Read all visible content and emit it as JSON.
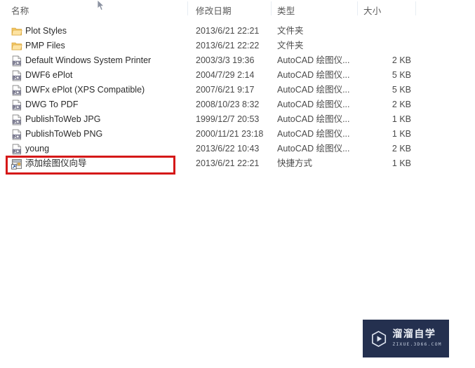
{
  "columns": {
    "name": "名称",
    "date": "修改日期",
    "type": "类型",
    "size": "大小"
  },
  "rows": [
    {
      "icon": "folder-icon",
      "name": "Plot Styles",
      "date": "2013/6/21 22:21",
      "type": "文件夹",
      "size": ""
    },
    {
      "icon": "folder-icon",
      "name": "PMP Files",
      "date": "2013/6/21 22:22",
      "type": "文件夹",
      "size": ""
    },
    {
      "icon": "pc3-file-icon",
      "name": "Default Windows System Printer",
      "date": "2003/3/3 19:36",
      "type": "AutoCAD 绘图仪...",
      "size": "2 KB"
    },
    {
      "icon": "pc3-file-icon",
      "name": "DWF6 ePlot",
      "date": "2004/7/29 2:14",
      "type": "AutoCAD 绘图仪...",
      "size": "5 KB"
    },
    {
      "icon": "pc3-file-icon",
      "name": "DWFx ePlot (XPS Compatible)",
      "date": "2007/6/21 9:17",
      "type": "AutoCAD 绘图仪...",
      "size": "5 KB"
    },
    {
      "icon": "pc3-file-icon",
      "name": "DWG To PDF",
      "date": "2008/10/23 8:32",
      "type": "AutoCAD 绘图仪...",
      "size": "2 KB"
    },
    {
      "icon": "pc3-file-icon",
      "name": "PublishToWeb JPG",
      "date": "1999/12/7 20:53",
      "type": "AutoCAD 绘图仪...",
      "size": "1 KB"
    },
    {
      "icon": "pc3-file-icon",
      "name": "PublishToWeb PNG",
      "date": "2000/11/21 23:18",
      "type": "AutoCAD 绘图仪...",
      "size": "1 KB"
    },
    {
      "icon": "pc3-file-icon",
      "name": "young",
      "date": "2013/6/22 10:43",
      "type": "AutoCAD 绘图仪...",
      "size": "2 KB"
    },
    {
      "icon": "shortcut-wizard-icon",
      "name": "添加绘图仪向导",
      "date": "2013/6/21 22:21",
      "type": "快捷方式",
      "size": "1 KB"
    }
  ],
  "annotation": {
    "highlight_row_index": 9,
    "color": "#d51818"
  },
  "watermark": {
    "title": "溜溜自学",
    "subtitle": "ZIXUE.3D66.COM",
    "background": "#24304f"
  }
}
